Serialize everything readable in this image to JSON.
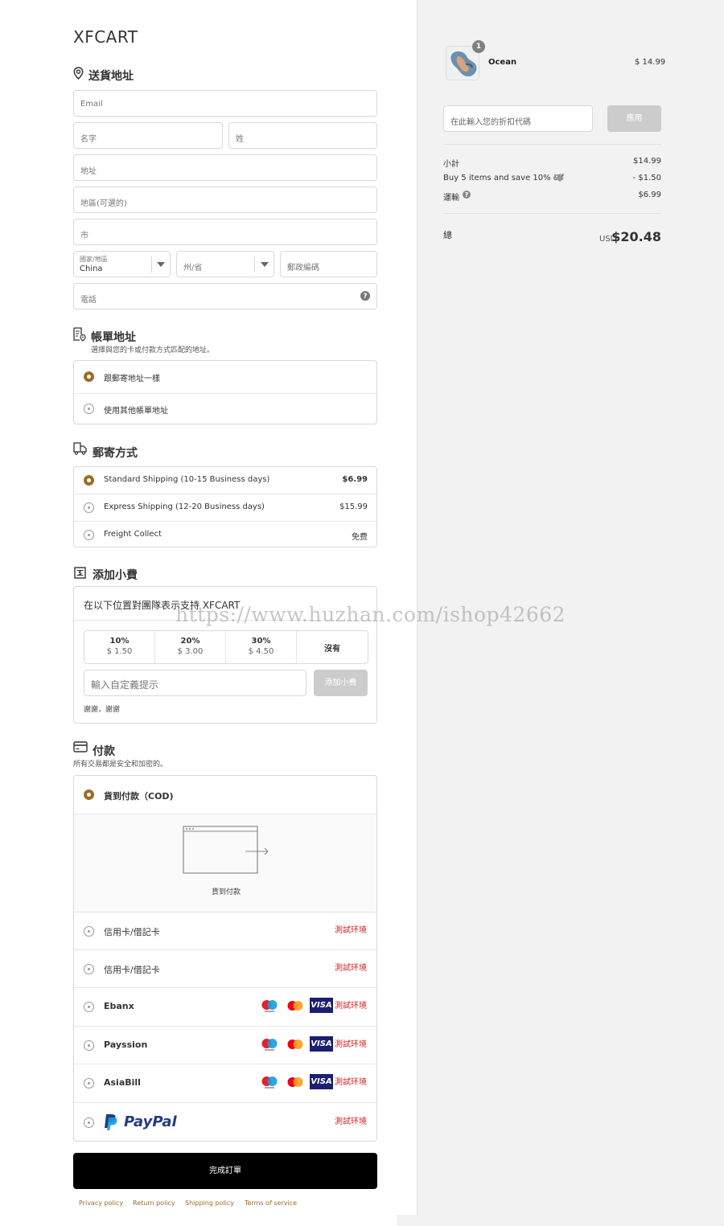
{
  "brand": "XFCART",
  "shipping_address": {
    "title": "送貨地址",
    "email_placeholder": "Email",
    "first_name_placeholder": "名字",
    "last_name_placeholder": "姓",
    "address_placeholder": "地址",
    "address2_placeholder": "地區(可選的)",
    "city_placeholder": "市",
    "country_label": "國家/地區",
    "country_value": "China",
    "state_placeholder": "州/省",
    "zip_placeholder": "郵政編碼",
    "phone_placeholder": "電話"
  },
  "billing": {
    "title": "帳單地址",
    "subtitle": "選擇與您的卡或付款方式匹配的地址。",
    "options": [
      "跟郵寄地址一樣",
      "使用其他帳單地址"
    ],
    "selected_index": 0
  },
  "shipping_method": {
    "title": "郵寄方式",
    "options": [
      {
        "label": "Standard Shipping (10-15 Business days)",
        "price": "$6.99"
      },
      {
        "label": "Express Shipping (12-20 Business days)",
        "price": "$15.99"
      },
      {
        "label": "Freight Collect",
        "price": "免费"
      }
    ],
    "selected_index": 0
  },
  "tip": {
    "title": "添加小費",
    "prompt": "在以下位置對團隊表示支持 XFCART",
    "options": [
      {
        "pct": "10%",
        "amount": "$ 1.50"
      },
      {
        "pct": "20%",
        "amount": "$ 3.00"
      },
      {
        "pct": "30%",
        "amount": "$ 4.50"
      }
    ],
    "none_label": "沒有",
    "custom_placeholder": "輸入自定義提示",
    "add_button": "添加小費",
    "thanks": "謝謝，謝謝"
  },
  "payment": {
    "title": "付款",
    "subtitle": "所有交易都是安全和加密的。",
    "cod_label": "貨到付款（COD)",
    "cod_caption": "貨到付款",
    "methods": [
      {
        "label": "信用卡/借記卡",
        "tag": "測試环境",
        "cards": false
      },
      {
        "label": "信用卡/借記卡",
        "tag": "測試环境",
        "cards": false
      },
      {
        "label": "Ebanx",
        "tag": "測試环境",
        "cards": true
      },
      {
        "label": "Payssion",
        "tag": "測試环境",
        "cards": true
      },
      {
        "label": "AsiaBill",
        "tag": "測試环境",
        "cards": true
      },
      {
        "label": "PayPal",
        "tag": "測試环境",
        "cards": false
      }
    ],
    "visa_text": "VISA"
  },
  "complete_button": "完成訂單",
  "footer_links": [
    "Privacy policy",
    "Return policy",
    "Shipping policy",
    "Terms of service"
  ],
  "summary": {
    "product_name": "Ocean",
    "product_qty": "1",
    "product_price": "$ 14.99",
    "discount_placeholder": "在此輸入您的折扣代碼",
    "apply_button": "應用",
    "subtotal_label": "小計",
    "subtotal_value": "$14.99",
    "discount_label": "Buy 5 items and save 10% off",
    "discount_value": "- $1.50",
    "shipping_label": "運輸",
    "shipping_value": "$6.99",
    "total_label": "總",
    "currency": "USD",
    "total_value": "$20.48"
  },
  "watermark": "https://www.huzhan.com/ishop42662",
  "colors": {
    "accent": "#9c6b2a",
    "test_tag": "#e02020",
    "button_bg": "#000000",
    "apply_bg": "#cccccc"
  }
}
